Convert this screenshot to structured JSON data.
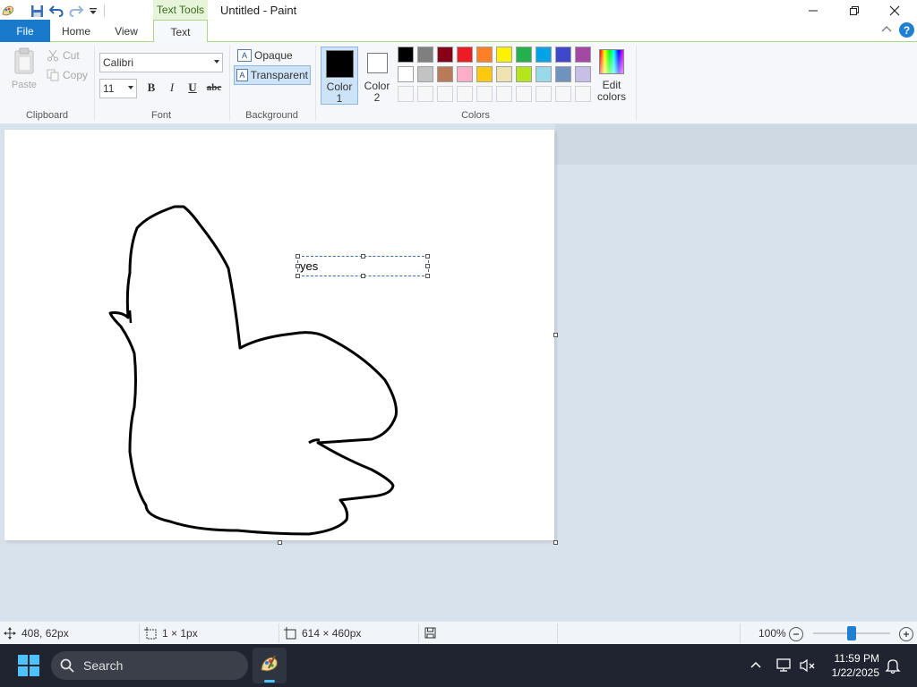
{
  "window": {
    "title": "Untitled - Paint",
    "context_tab": "Text Tools"
  },
  "tabs": {
    "file": "File",
    "home": "Home",
    "view": "View",
    "text": "Text"
  },
  "clipboard": {
    "paste": "Paste",
    "cut": "Cut",
    "copy": "Copy",
    "label": "Clipboard"
  },
  "font": {
    "family": "Calibri",
    "size": "11",
    "bold": "B",
    "italic": "I",
    "underline": "U",
    "strikethrough": "abc",
    "label": "Font"
  },
  "background": {
    "opaque": "Opaque",
    "transparent": "Transparent",
    "selected": "Transparent",
    "label": "Background"
  },
  "colors": {
    "color1_label": "Color",
    "color1_num": "1",
    "color2_label": "Color",
    "color2_num": "2",
    "color1": "#000000",
    "color2": "#ffffff",
    "row1": [
      "#000000",
      "#7f7f7f",
      "#880015",
      "#ed1c24",
      "#ff7f27",
      "#fff200",
      "#22b14c",
      "#00a2e8",
      "#3f48cc",
      "#a349a4"
    ],
    "row2": [
      "#ffffff",
      "#c3c3c3",
      "#b97a57",
      "#ffaec9",
      "#ffc90e",
      "#efe4b0",
      "#b5e61d",
      "#99d9ea",
      "#7092be",
      "#c8bfe7"
    ],
    "edit_label_1": "Edit",
    "edit_label_2": "colors",
    "label": "Colors"
  },
  "canvas": {
    "text_content": "yes"
  },
  "status": {
    "cursor_pos": "408, 62px",
    "selection_size": "1 × 1px",
    "image_size": "614 × 460px",
    "zoom": "100%"
  },
  "taskbar": {
    "search_placeholder": "Search",
    "time": "11:59 PM",
    "date": "1/22/2025"
  }
}
